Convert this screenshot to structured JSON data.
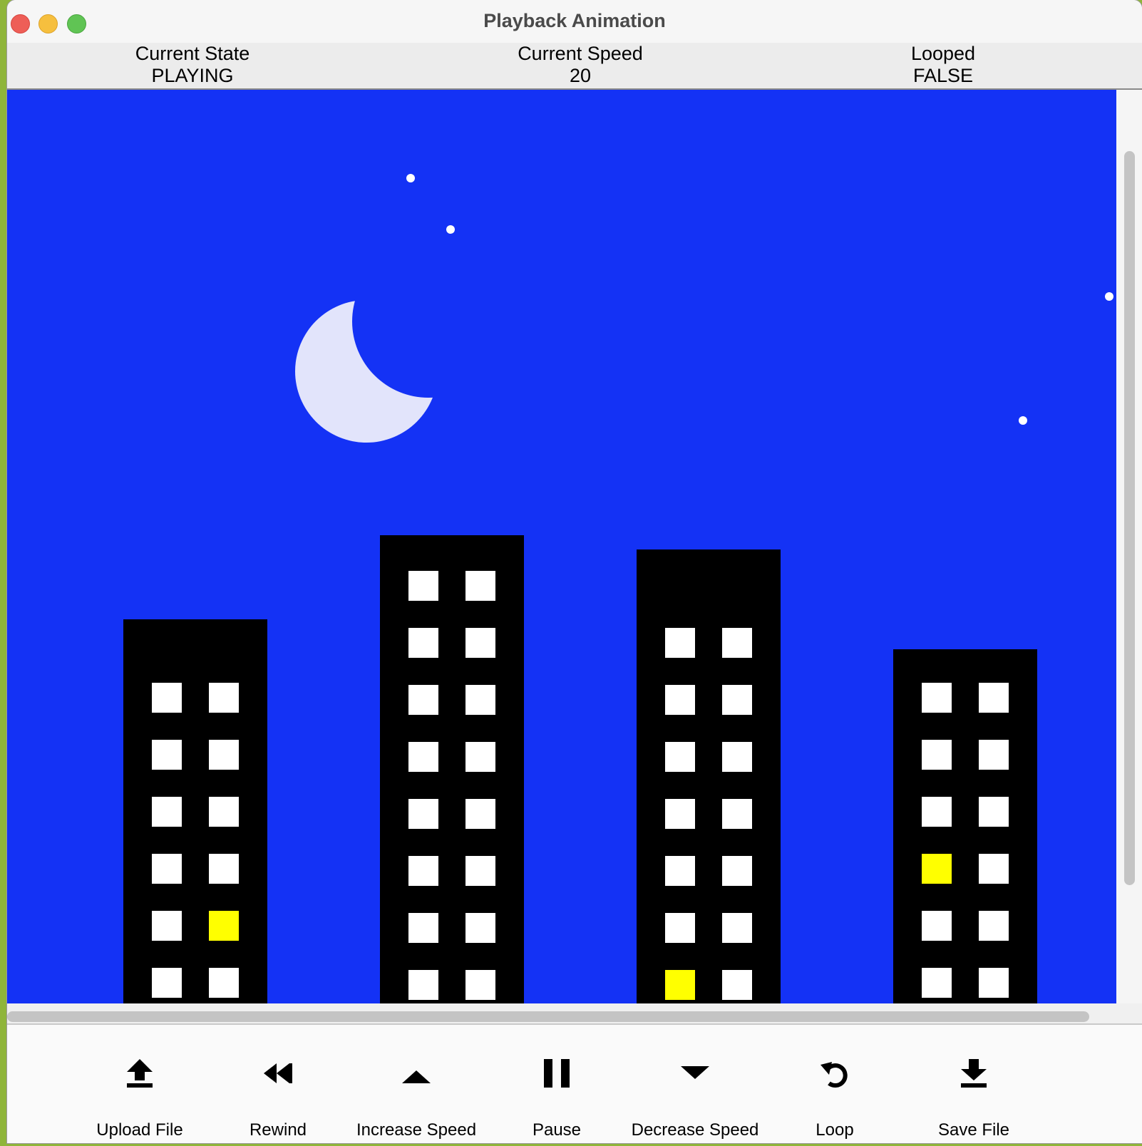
{
  "window": {
    "title": "Playback Animation"
  },
  "status": {
    "state_label": "Current State",
    "state_value": "PLAYING",
    "speed_label": "Current Speed",
    "speed_value": "20",
    "looped_label": "Looped",
    "looped_value": "FALSE"
  },
  "scene": {
    "sky_color": "#1432f5",
    "moon_color": "#e2e4fb",
    "star_color": "#ffffff",
    "building_color": "#000000",
    "window_color": "#ffffff",
    "lit_window_color": "#ffff00"
  },
  "toolbar": {
    "upload_label": "Upload File",
    "rewind_label": "Rewind",
    "increase_label": "Increase Speed",
    "pause_label": "Pause",
    "decrease_label": "Decrease Speed",
    "loop_label": "Loop",
    "save_label": "Save File"
  }
}
